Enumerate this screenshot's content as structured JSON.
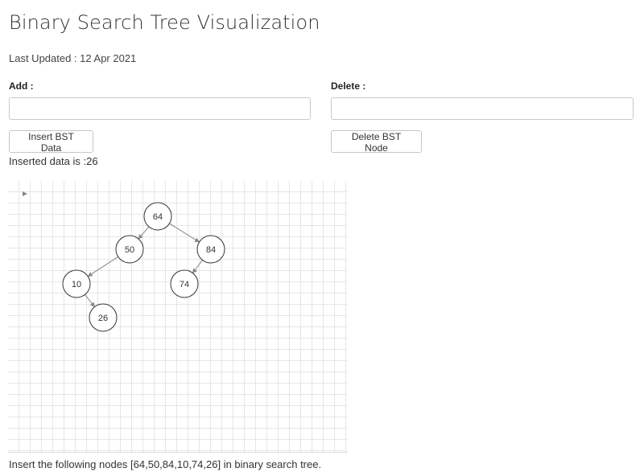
{
  "page": {
    "title": "Binary Search Tree Visualization",
    "last_updated": "Last Updated : 12 Apr 2021"
  },
  "add": {
    "label": "Add :",
    "value": "",
    "button_label": "Insert BST Data"
  },
  "delete": {
    "label": "Delete :",
    "value": "",
    "button_label": "Delete BST Node"
  },
  "status": {
    "inserted_text": "Inserted data is :26"
  },
  "tree": {
    "insert_order": [
      64,
      50,
      84,
      10,
      74,
      26
    ],
    "nodes": [
      {
        "value": "64",
        "left": "50",
        "right": "84"
      },
      {
        "value": "50",
        "left": "10",
        "right": null
      },
      {
        "value": "84",
        "left": "74",
        "right": null
      },
      {
        "value": "10",
        "left": null,
        "right": "26"
      },
      {
        "value": "74",
        "left": null,
        "right": null
      },
      {
        "value": "26",
        "left": null,
        "right": null
      }
    ]
  },
  "footer": {
    "description": "Insert the following nodes [64,50,84,10,74,26] in binary search tree."
  },
  "colors": {
    "node_stroke": "#333333",
    "edge": "#888888",
    "grid": "#e6e6e6"
  }
}
